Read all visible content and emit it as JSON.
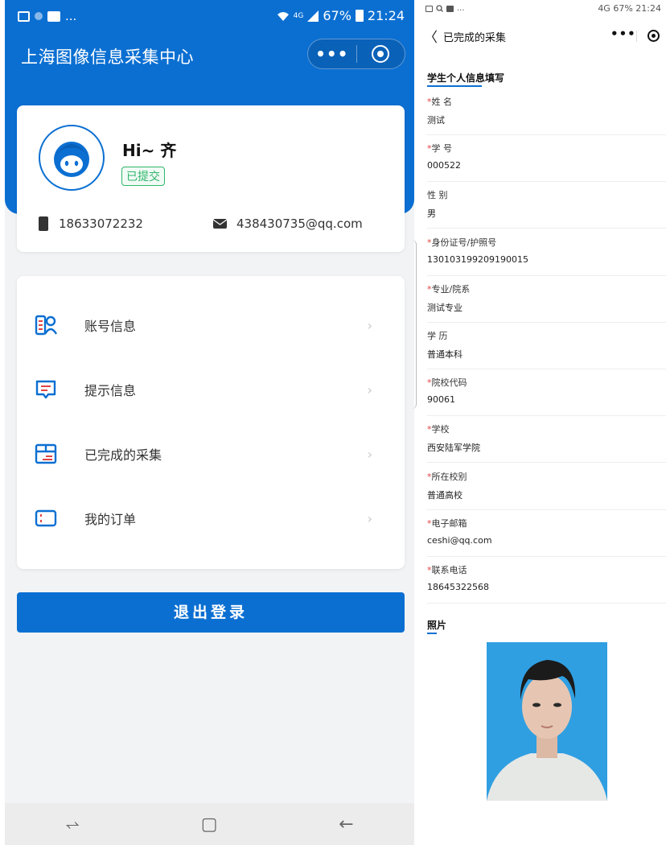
{
  "left": {
    "status": {
      "dots": "...",
      "network": "4G",
      "battery": "67%",
      "time": "21:24"
    },
    "app_title": "上海图像信息采集中心",
    "capsule": {
      "more": "•••"
    },
    "profile": {
      "greeting": "Hi~ 齐",
      "status_badge": "已提交",
      "phone": "18633072232",
      "email": "438430735@qq.com"
    },
    "menu": [
      {
        "label": "账号信息",
        "icon": "account-info-icon"
      },
      {
        "label": "提示信息",
        "icon": "message-icon"
      },
      {
        "label": "已完成的采集",
        "icon": "box-icon"
      },
      {
        "label": "我的订单",
        "icon": "ticket-icon"
      }
    ],
    "chevron": "›",
    "logout_label": "退出登录",
    "nav": {
      "recent": "⥋",
      "home": "▢",
      "back": "←"
    },
    "colors": {
      "primary": "#0b6fd2",
      "accent_red": "#e04343",
      "success": "#2fb56a"
    }
  },
  "right": {
    "status": {
      "dots": "...",
      "network": "4G",
      "battery": "67%",
      "time": "21:24"
    },
    "nav_title": "已完成的采集",
    "back": "〈",
    "more": "•••",
    "section_title": "学生个人信息填写",
    "fields": [
      {
        "label": "姓 名",
        "required": true,
        "value": "测试"
      },
      {
        "label": "学 号",
        "required": true,
        "value": "000522"
      },
      {
        "label": "性 别",
        "required": false,
        "value": "男"
      },
      {
        "label": "身份证号/护照号",
        "required": true,
        "value": "130103199209190015"
      },
      {
        "label": "专业/院系",
        "required": true,
        "value": "测试专业"
      },
      {
        "label": "学 历",
        "required": false,
        "value": "普通本科"
      },
      {
        "label": "院校代码",
        "required": true,
        "value": "90061"
      },
      {
        "label": "学校",
        "required": true,
        "value": "西安陆军学院"
      },
      {
        "label": "所在校别",
        "required": true,
        "value": "普通高校"
      },
      {
        "label": "电子邮箱",
        "required": true,
        "value": "ceshi@qq.com"
      },
      {
        "label": "联系电话",
        "required": true,
        "value": "18645322568"
      }
    ],
    "photo_title": "照片",
    "required_mark": "*"
  }
}
